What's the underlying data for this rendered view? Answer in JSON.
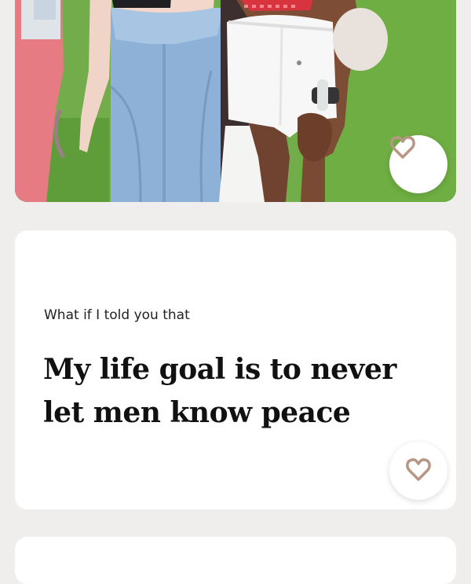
{
  "profile": {
    "photo": {
      "description_icon": "photo-image"
    },
    "prompt": {
      "question": "What if I told you that",
      "answer": "My life goal is to never let men know peace"
    },
    "icons": {
      "like": "heart-icon"
    },
    "colors": {
      "background": "#efeeed",
      "card": "#ffffff",
      "heart_stroke": "#b89685"
    }
  }
}
